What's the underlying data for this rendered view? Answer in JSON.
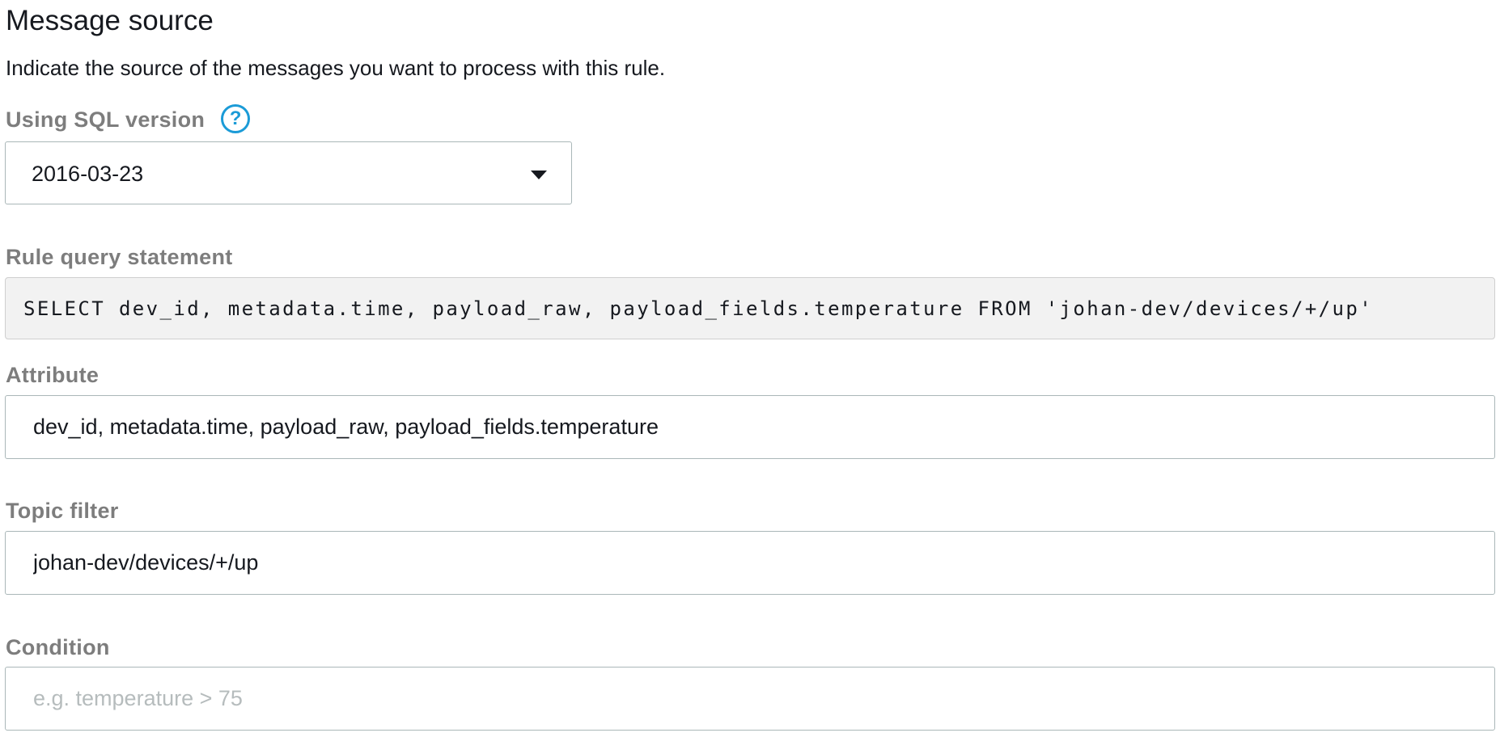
{
  "section": {
    "title": "Message source",
    "description": "Indicate the source of the messages you want to process with this rule."
  },
  "sql_version": {
    "label": "Using SQL version",
    "help_icon": "question-circle-icon",
    "selected": "2016-03-23"
  },
  "rule_query": {
    "label": "Rule query statement",
    "statement": "SELECT dev_id, metadata.time, payload_raw, payload_fields.temperature FROM 'johan-dev/devices/+/up'"
  },
  "attribute": {
    "label": "Attribute",
    "value": "dev_id, metadata.time, payload_raw, payload_fields.temperature"
  },
  "topic_filter": {
    "label": "Topic filter",
    "value": "johan-dev/devices/+/up"
  },
  "condition": {
    "label": "Condition",
    "value": "",
    "placeholder": "e.g. temperature > 75"
  },
  "colors": {
    "label_gray": "#7d7d7d",
    "help_blue": "#1b9bd7",
    "query_bg": "#f2f2f2",
    "input_border": "#aab7b8"
  }
}
